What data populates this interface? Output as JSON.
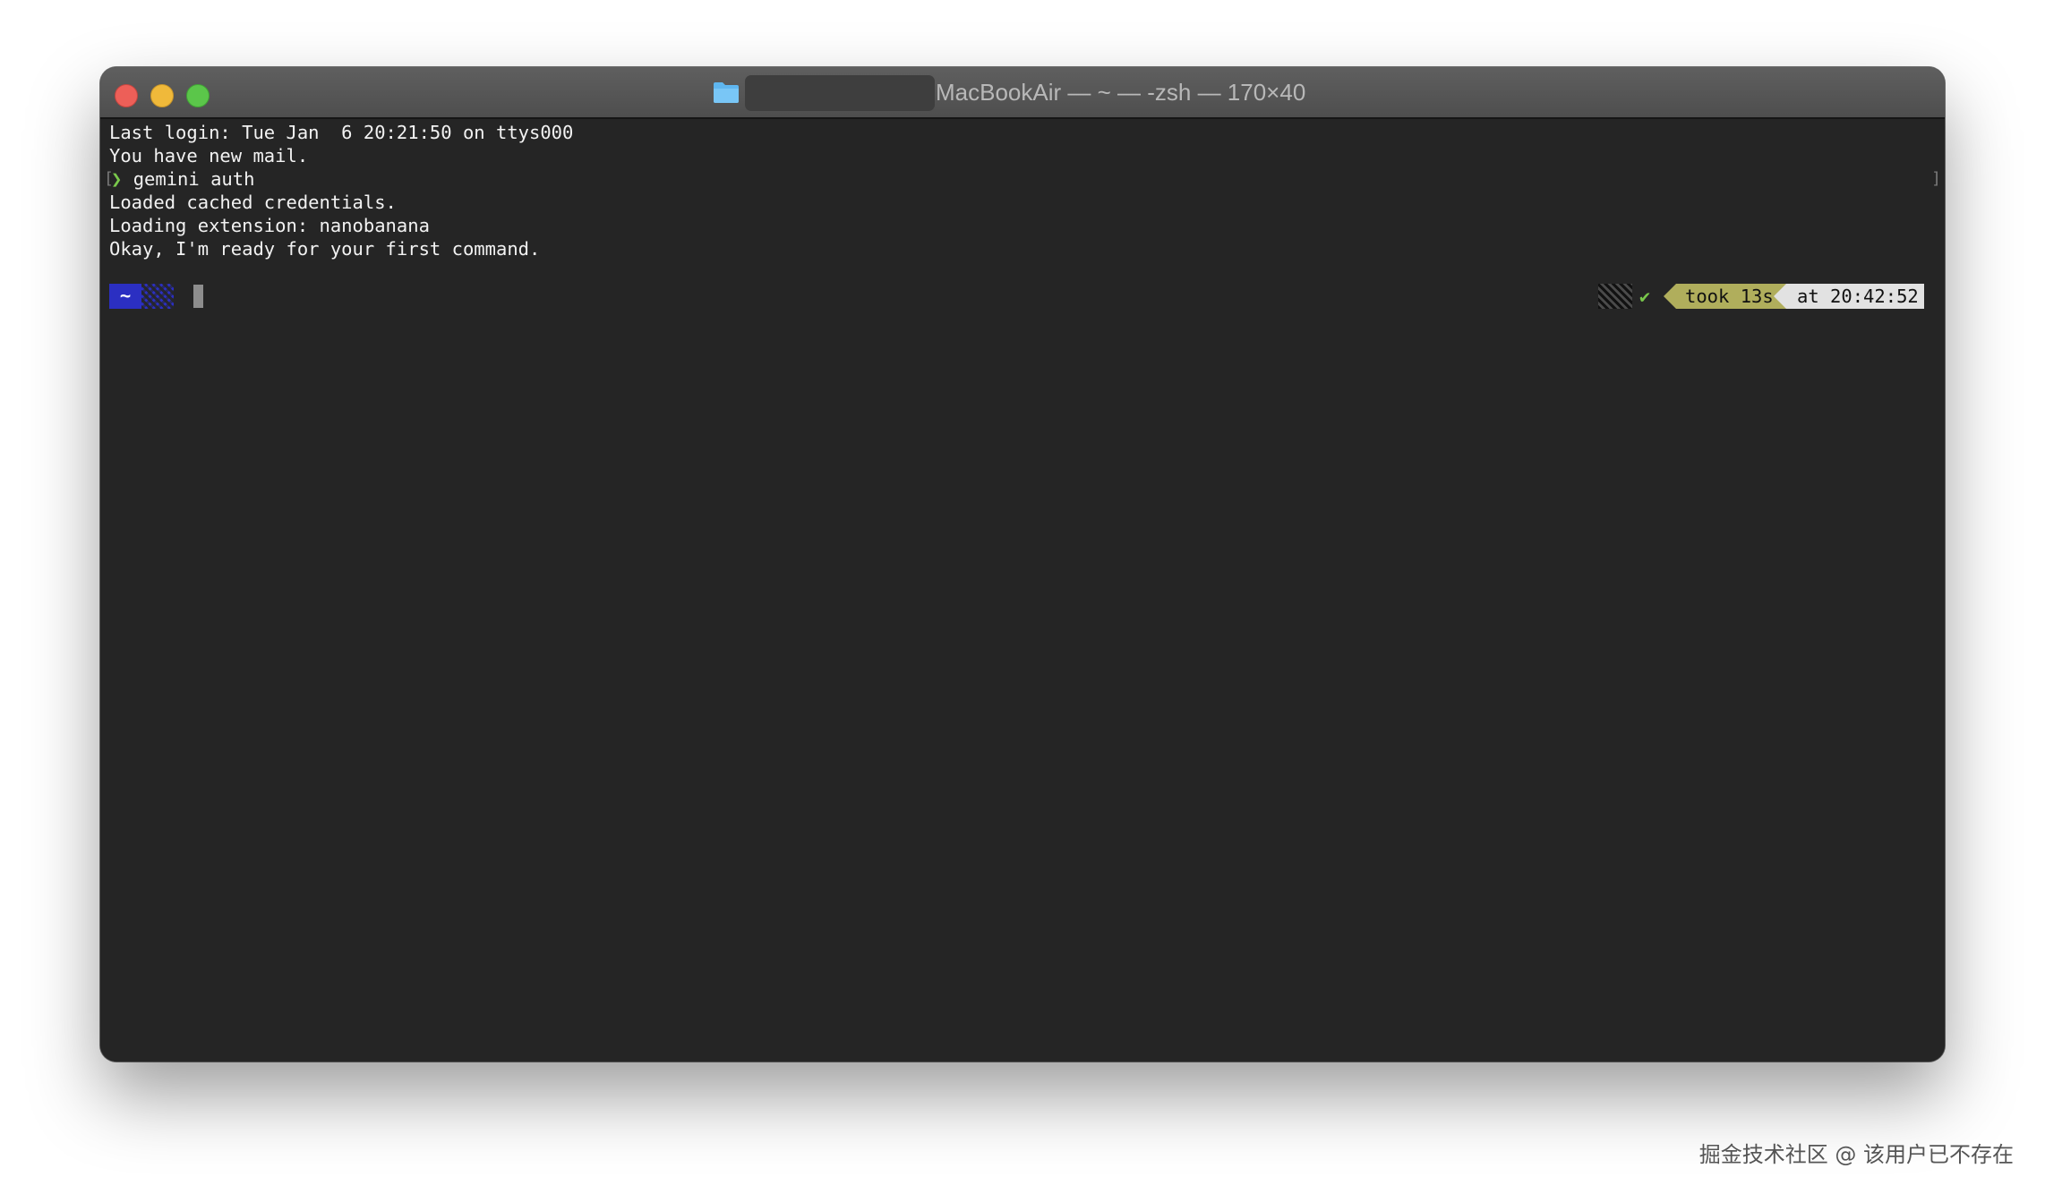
{
  "window": {
    "title": "MacBookAir — ~ — -zsh — 170×40",
    "folder_icon": "folder-icon"
  },
  "terminal": {
    "lines": [
      "Last login: Tue Jan  6 20:21:50 on ttys000",
      "You have new mail.",
      "gemini auth",
      "Loaded cached credentials.",
      "Loading extension: nanobanana",
      "Okay, I'm ready for your first command."
    ],
    "prompt_glyph": "❯",
    "left_bracket": "[",
    "right_bracket": "]",
    "prompt": {
      "dir": "~"
    },
    "right_prompt": {
      "status_icon": "✔",
      "took": "took 13s",
      "at": "at 20:42:52"
    }
  },
  "colors": {
    "terminal_bg": "#252525",
    "prompt_dir_bg": "#2b2fc2",
    "took_bg": "#b0ae5c",
    "at_bg": "#e2e2e2",
    "success_green": "#79c84b"
  },
  "watermark": "掘金技术社区 @ 该用户已不存在"
}
